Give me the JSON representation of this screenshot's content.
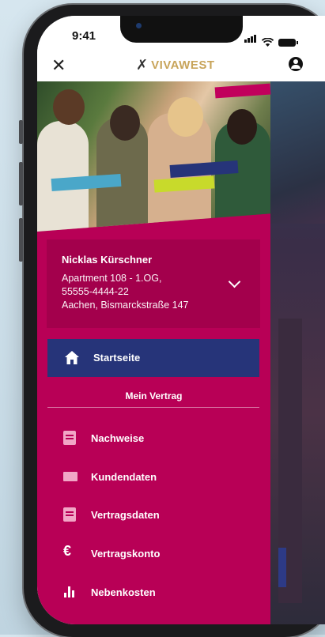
{
  "status_bar": {
    "time": "9:41"
  },
  "header": {
    "close_icon": "close-icon",
    "brand": "VIVAWEST",
    "account_icon": "account-icon"
  },
  "user_card": {
    "name": "Nicklas Kürschner",
    "address_line1": "Apartment 108 - 1.OG,",
    "address_line2": "55555-4444-22",
    "address_line3": "Aachen, Bismarckstraße 147"
  },
  "nav": {
    "home_label": "Startseite",
    "section_title": "Mein Vertrag",
    "items": [
      {
        "label": "Nachweise",
        "icon": "document-icon"
      },
      {
        "label": "Kundendaten",
        "icon": "id-card-icon"
      },
      {
        "label": "Vertragsdaten",
        "icon": "document-icon"
      },
      {
        "label": "Vertragskonto",
        "icon": "euro-icon"
      },
      {
        "label": "Nebenkosten",
        "icon": "bar-chart-icon"
      }
    ]
  },
  "colors": {
    "drawer": "#b80056",
    "active": "#263479",
    "brand_gold": "#c8a45a"
  }
}
